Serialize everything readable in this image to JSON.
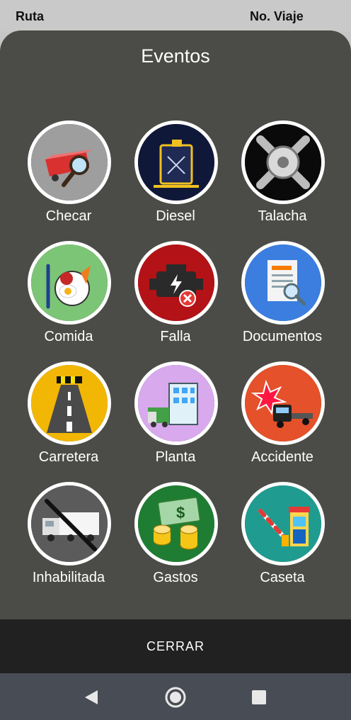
{
  "header": {
    "left": "Ruta",
    "right": "No. Viaje"
  },
  "dialog": {
    "title": "Eventos",
    "items": [
      {
        "label": "Checar",
        "icon": "trailer-magnifier-icon",
        "bg": "#9e9e9e"
      },
      {
        "label": "Diesel",
        "icon": "fuel-can-icon",
        "bg": "#10183a"
      },
      {
        "label": "Talacha",
        "icon": "tire-wrench-icon",
        "bg": "#0a0a0a"
      },
      {
        "label": "Comida",
        "icon": "food-plate-icon",
        "bg": "#7cc576"
      },
      {
        "label": "Falla",
        "icon": "engine-fault-icon",
        "bg": "#b31217"
      },
      {
        "label": "Documentos",
        "icon": "document-search-icon",
        "bg": "#3b7ee0"
      },
      {
        "label": "Carretera",
        "icon": "road-icon",
        "bg": "#f2b705"
      },
      {
        "label": "Planta",
        "icon": "truck-building-icon",
        "bg": "#d8a9ec"
      },
      {
        "label": "Accidente",
        "icon": "truck-crash-icon",
        "bg": "#e4512a"
      },
      {
        "label": "Inhabilitada",
        "icon": "truck-disabled-icon",
        "bg": "#5b5b5b"
      },
      {
        "label": "Gastos",
        "icon": "money-coins-icon",
        "bg": "#1e7d32"
      },
      {
        "label": "Caseta",
        "icon": "toll-booth-icon",
        "bg": "#1f9c8f"
      }
    ],
    "close_label": "CERRAR"
  },
  "navbar": {
    "back_icon": "back-triangle-icon",
    "home_icon": "home-circle-icon",
    "recents_icon": "recents-square-icon"
  }
}
